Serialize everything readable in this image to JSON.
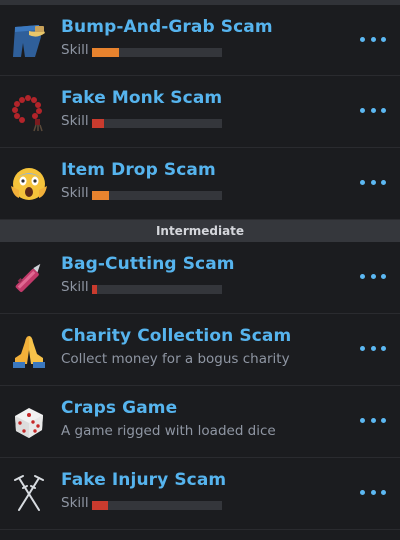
{
  "colors": {
    "accent": "#56b4ee",
    "skill_orange": "#e8832e",
    "skill_red": "#c93b2e",
    "more_dots": "#5cb8f2"
  },
  "section_intermediate": "Intermediate",
  "items": [
    {
      "title": "Bump-And-Grab Scam",
      "sub": "Skill",
      "skill": 0.21,
      "color": "#e8832e",
      "icon": "jeans-pocket-icon"
    },
    {
      "title": "Fake Monk Scam",
      "sub": "Skill",
      "skill": 0.09,
      "color": "#c93b2e",
      "icon": "prayer-beads-icon"
    },
    {
      "title": "Item Drop Scam",
      "sub": "Skill",
      "skill": 0.13,
      "color": "#e8832e",
      "icon": "screaming-face-icon"
    },
    {
      "title": "Bag-Cutting Scam",
      "sub": "Skill",
      "skill": 0.04,
      "color": "#c93b2e",
      "icon": "box-cutter-icon"
    },
    {
      "title": "Charity Collection Scam",
      "sub": "Collect money for a bogus charity",
      "icon": "praying-hands-icon"
    },
    {
      "title": "Craps Game",
      "sub": "A game rigged with loaded dice",
      "icon": "dice-icon"
    },
    {
      "title": "Fake Injury Scam",
      "sub": "Skill",
      "skill": 0.12,
      "color": "#c93b2e",
      "icon": "crutches-icon"
    }
  ]
}
